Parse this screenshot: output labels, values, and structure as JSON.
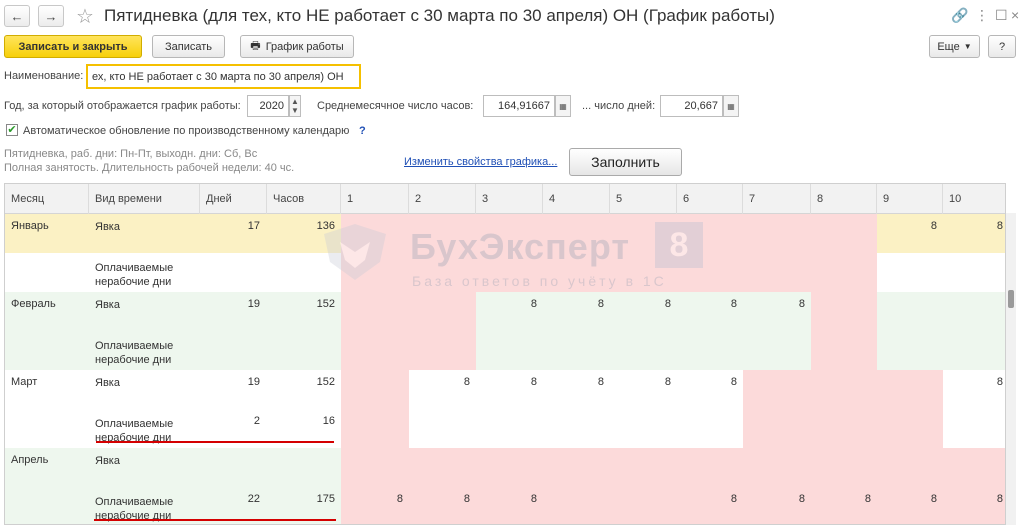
{
  "window": {
    "title": "Пятидневка (для тех, кто НЕ работает с 30 марта по 30 апреля) ОН (График работы)"
  },
  "toolbar": {
    "save_close": "Записать и закрыть",
    "save": "Записать",
    "schedule": "График работы",
    "more": "Еще",
    "help": "?"
  },
  "form": {
    "name_label": "Наименование:",
    "name_value": "ех, кто НЕ работает с 30 марта по 30 апреля) ОН",
    "year_label": "Год, за который отображается график работы:",
    "year_value": "2020",
    "avg_hours_label": "Среднемесячное число часов:",
    "avg_hours_value": "164,91667",
    "days_label": "... число дней:",
    "days_value": "20,667",
    "auto_update_label": "Автоматическое обновление по производственному календарю",
    "auto_update_help": "?",
    "desc_line1": "Пятидневка, раб. дни: Пн-Пт, выходн. дни: Сб, Вс",
    "desc_line2": "Полная занятость. Длительность рабочей недели: 40 чс.",
    "change_link": "Изменить свойства графика...",
    "fill_button": "Заполнить"
  },
  "grid": {
    "headers": [
      "Месяц",
      "Вид времени",
      "Дней",
      "Часов"
    ],
    "day_headers": [
      "1",
      "2",
      "3",
      "4",
      "5",
      "6",
      "7",
      "8",
      "9",
      "10"
    ],
    "rows": [
      {
        "month": "Январь",
        "type": "Явка",
        "days": "17",
        "hours": "136",
        "vals": [
          "",
          "",
          "",
          "",
          "",
          "",
          "",
          "",
          "8",
          "8"
        ]
      },
      {
        "month": "",
        "type": "Оплачиваемые нерабочие дни",
        "days": "",
        "hours": "",
        "vals": [
          "",
          "",
          "",
          "",
          "",
          "",
          "",
          "",
          "",
          ""
        ]
      },
      {
        "month": "Февраль",
        "type": "Явка",
        "days": "19",
        "hours": "152",
        "vals": [
          "",
          "",
          "8",
          "8",
          "8",
          "8",
          "8",
          "",
          "",
          ""
        ]
      },
      {
        "month": "",
        "type": "Оплачиваемые нерабочие дни",
        "days": "",
        "hours": "",
        "vals": [
          "",
          "",
          "",
          "",
          "",
          "",
          "",
          "",
          "",
          ""
        ]
      },
      {
        "month": "Март",
        "type": "Явка",
        "days": "19",
        "hours": "152",
        "vals": [
          "",
          "8",
          "8",
          "8",
          "8",
          "8",
          "",
          "",
          "",
          "8"
        ]
      },
      {
        "month": "",
        "type": "Оплачиваемые нерабочие дни",
        "days": "2",
        "hours": "16",
        "vals": [
          "",
          "",
          "",
          "",
          "",
          "",
          "",
          "",
          "",
          ""
        ]
      },
      {
        "month": "Апрель",
        "type": "Явка",
        "days": "",
        "hours": "",
        "vals": [
          "",
          "",
          "",
          "",
          "",
          "",
          "",
          "",
          "",
          ""
        ]
      },
      {
        "month": "",
        "type": "Оплачиваемые нерабочие дни",
        "days": "22",
        "hours": "175",
        "vals": [
          "8",
          "8",
          "8",
          "",
          "",
          "8",
          "8",
          "8",
          "8",
          "8"
        ]
      }
    ]
  },
  "watermark": {
    "brand": "БухЭксперт",
    "digit": "8",
    "tagline": "База ответов по учёту в 1С"
  },
  "colors": {
    "primary_button": "#f7d00a",
    "focus_border": "#f5c000",
    "selected_row": "#fbf1c4",
    "green_cell": "#eef7ee",
    "pink_cell": "#fcdada",
    "red_underline": "#d40000",
    "link": "#1f4fb5"
  }
}
